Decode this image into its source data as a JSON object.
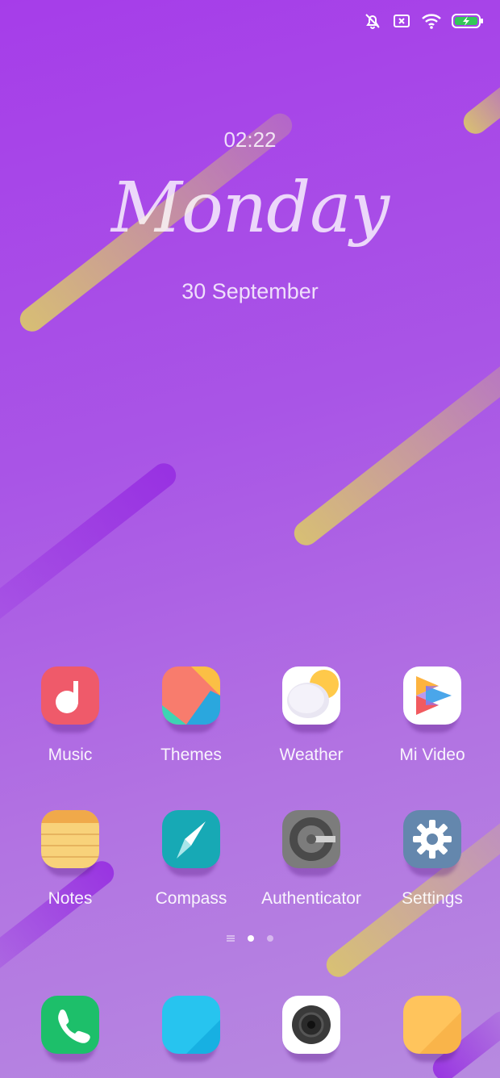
{
  "lockscreen": {
    "time": "02:22",
    "day": "Monday",
    "date": "30 September"
  },
  "status_bar": {
    "icons": [
      "alarm-off-icon",
      "sim-off-icon",
      "wifi-icon",
      "battery-charging-icon"
    ]
  },
  "apps_row1": [
    {
      "label": "Music",
      "icon": "music-icon"
    },
    {
      "label": "Themes",
      "icon": "themes-icon"
    },
    {
      "label": "Weather",
      "icon": "weather-icon"
    },
    {
      "label": "Mi Video",
      "icon": "mi-video-icon"
    }
  ],
  "apps_row2": [
    {
      "label": "Notes",
      "icon": "notes-icon"
    },
    {
      "label": "Compass",
      "icon": "compass-icon"
    },
    {
      "label": "Authenticator",
      "icon": "authenticator-icon"
    },
    {
      "label": "Settings",
      "icon": "settings-icon"
    }
  ],
  "dock": [
    {
      "icon": "phone-icon"
    },
    {
      "icon": "messages-icon"
    },
    {
      "icon": "camera-icon"
    },
    {
      "icon": "notes-folder-icon"
    }
  ],
  "page_indicator": {
    "pages": 2,
    "active": 1
  },
  "colors": {
    "background_top": "#a63de9",
    "background_bottom": "#b78ae0",
    "accent_yellow": "#dac46e"
  }
}
